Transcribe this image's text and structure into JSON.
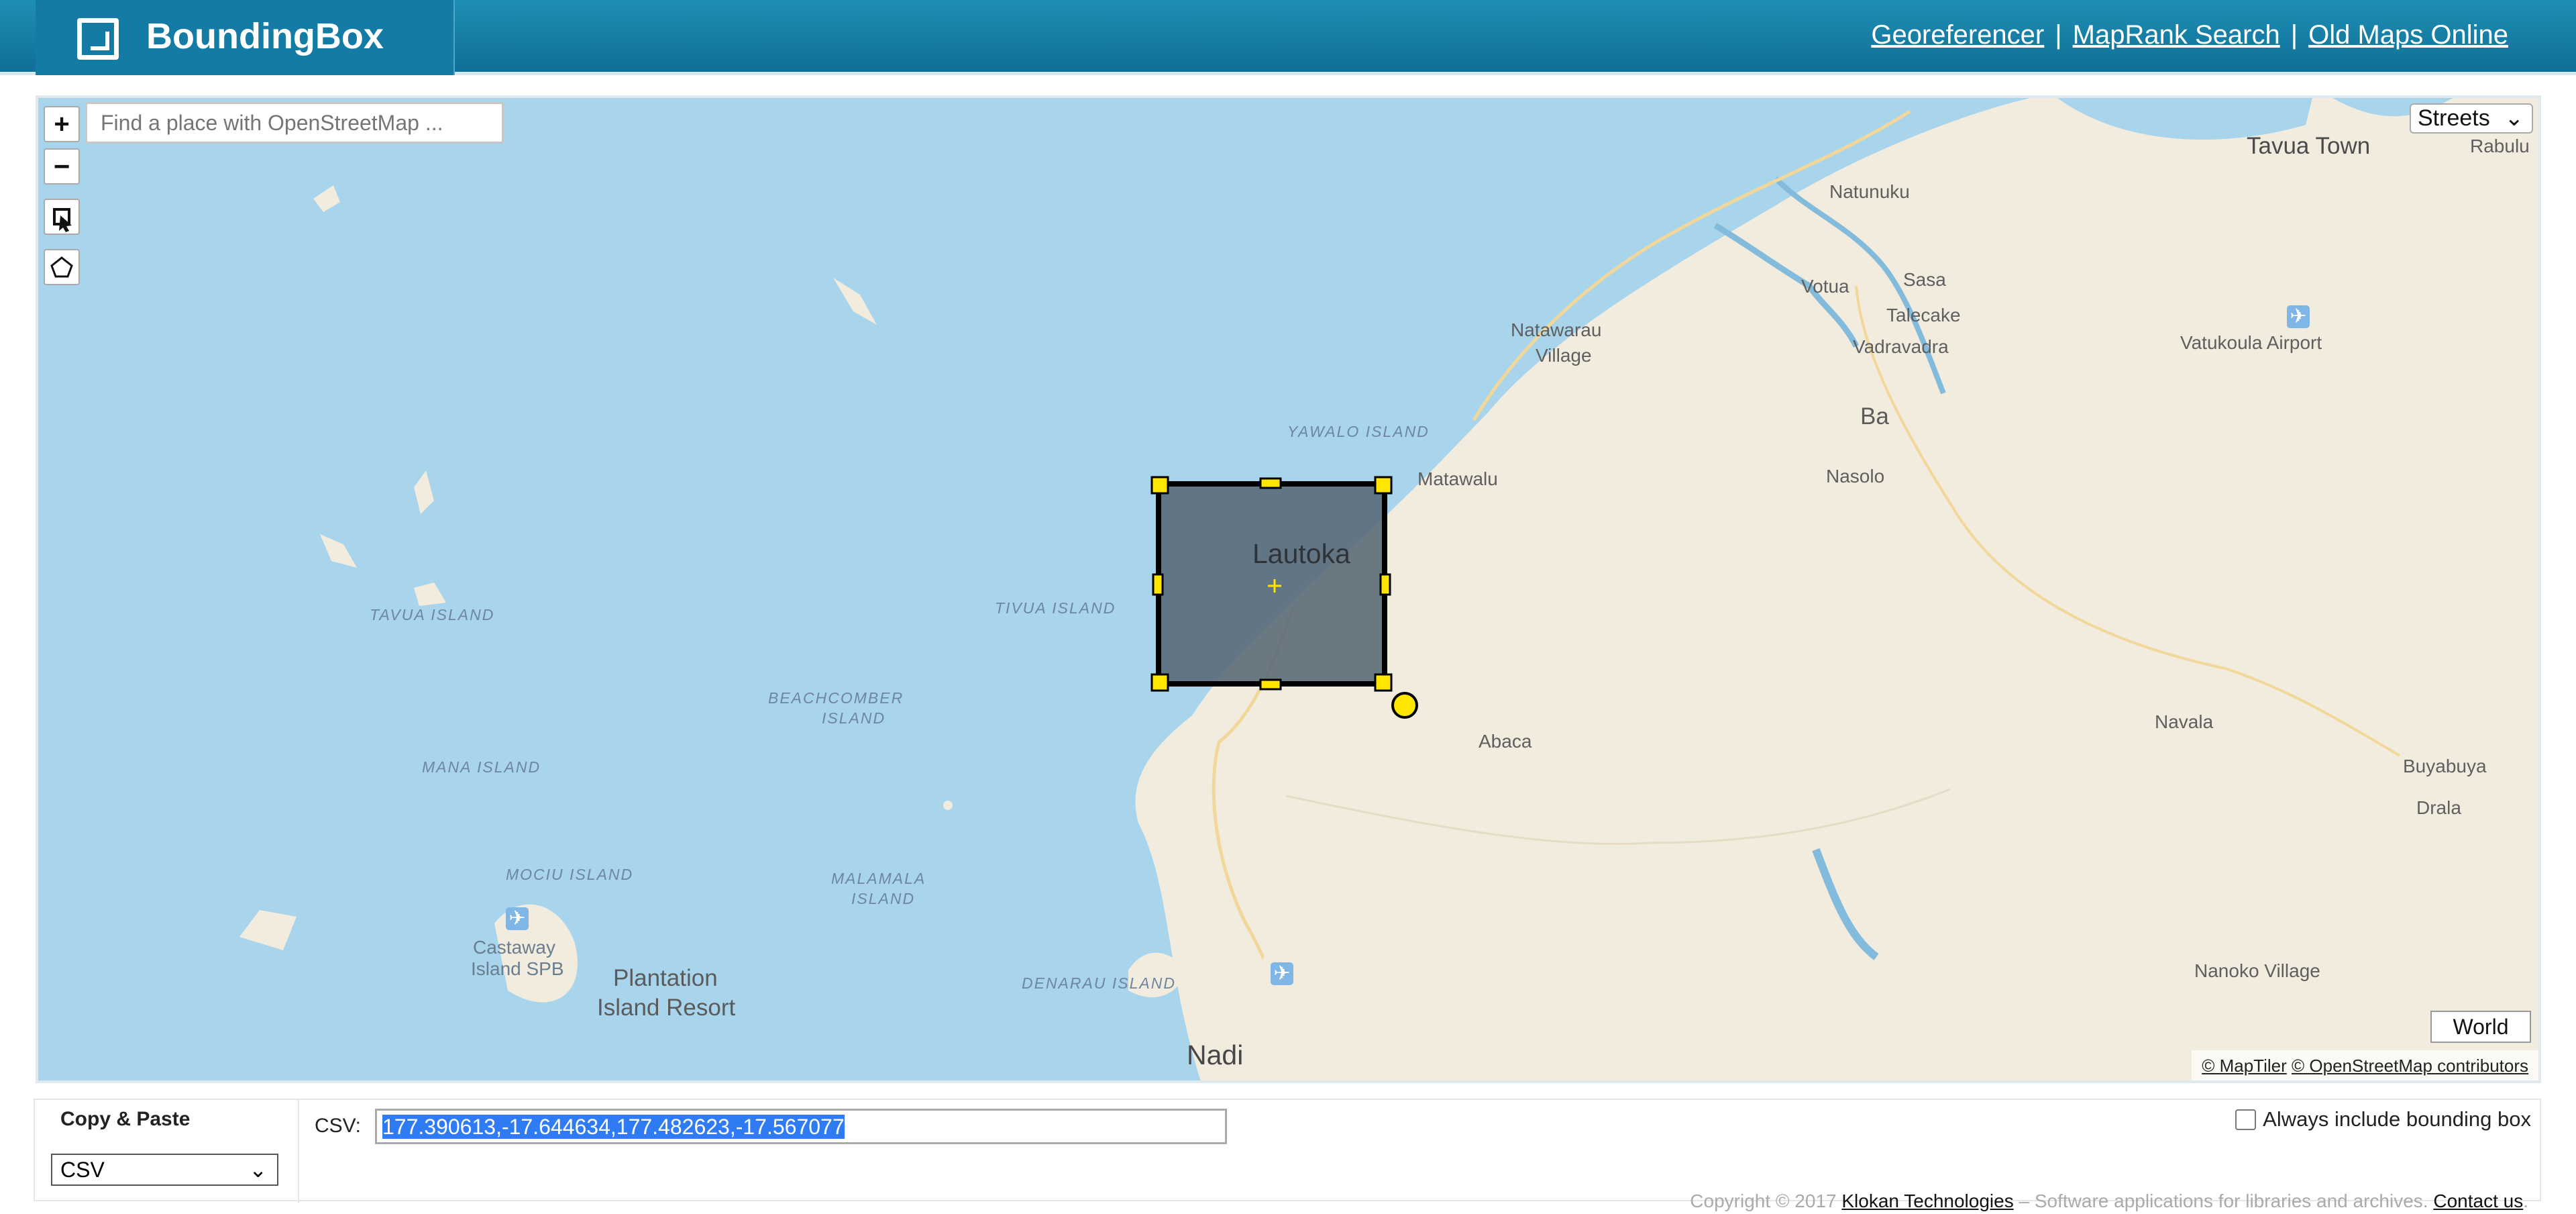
{
  "header": {
    "brand": "BoundingBox",
    "links": [
      "Georeferencer",
      "MapRank Search",
      "Old Maps Online"
    ],
    "separator": "|"
  },
  "map": {
    "search_placeholder": "Find a place with OpenStreetMap ...",
    "zoom_in": "+",
    "zoom_out": "−",
    "layer": "Streets",
    "world": "World",
    "attribution": [
      "© MapTiler",
      "© OpenStreetMap contributors"
    ],
    "labels": {
      "tavua_town": "Tavua Town",
      "rabulu": "Rabulu",
      "natunuku": "Natunuku",
      "votua": "Votua",
      "sasa": "Sasa",
      "talecake": "Talecake",
      "vadravadra": "Vadravadra",
      "natawarau": "Natawarau",
      "village": "Village",
      "vatukoula": "Vatukoula Airport",
      "yawalo": "YAWALO ISLAND",
      "ba": "Ba",
      "nasolo": "Nasolo",
      "matawalu": "Matawalu",
      "lautoka": "Lautoka",
      "tivua": "TIVUA ISLAND",
      "tavua_island": "TAVUA ISLAND",
      "beachcomber": "BEACHCOMBER",
      "island": "ISLAND",
      "abaca": "Abaca",
      "navala": "Navala",
      "buyabuya": "Buyabuya",
      "drala": "Drala",
      "mana": "MANA ISLAND",
      "mociu": "MOCIU ISLAND",
      "malamala": "MALAMALA",
      "castaway": "Castaway",
      "castaway2": "Island SPB",
      "plantation": "Plantation",
      "resort": "Island Resort",
      "denarau": "DENARAU ISLAND",
      "nadi": "Nadi",
      "nanoko": "Nanoko Village"
    },
    "colors": {
      "water": "#a8d4ec",
      "land": "#f2ecdf",
      "bbox_fill": "#566875",
      "handle": "#ffe600"
    }
  },
  "bottom": {
    "copy_title": "Copy & Paste",
    "format": "CSV",
    "csv_label": "CSV:",
    "csv_value": "177.390613,-17.644634,177.482623,-17.567077",
    "checkbox_label": "Always include bounding box"
  },
  "footer": {
    "prefix": "Copyright © 2017 ",
    "company": "Klokan Technologies",
    "middle": " – Software applications for libraries and archives. ",
    "contact": "Contact us",
    "suffix": "."
  }
}
